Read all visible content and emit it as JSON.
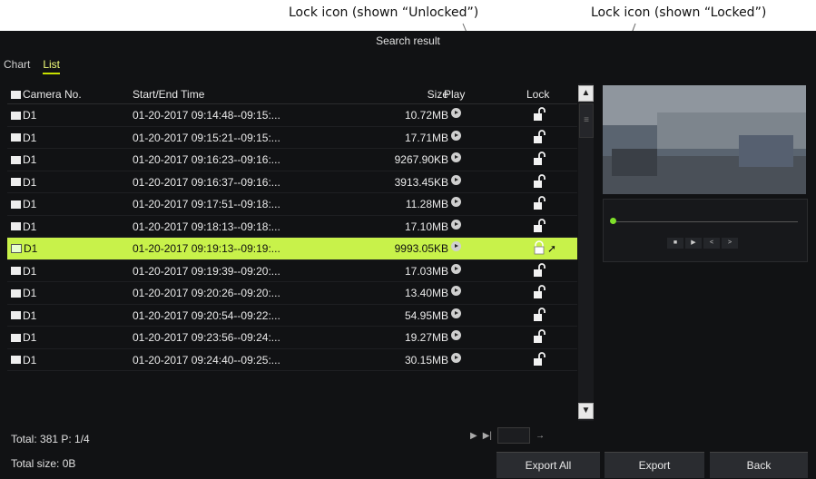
{
  "callouts": {
    "unlocked": "Lock icon (shown “Unlocked”)",
    "locked": "Lock icon (shown “Locked”)"
  },
  "window": {
    "title": "Search result"
  },
  "tabs": [
    {
      "label": "Chart",
      "active": false
    },
    {
      "label": "List",
      "active": true
    }
  ],
  "table": {
    "headers": {
      "camera": "Camera No.",
      "time": "Start/End Time",
      "size": "Size",
      "play": "Play",
      "lock": "Lock"
    },
    "rows": [
      {
        "camera": "D1",
        "time": "01-20-2017 09:14:48--09:15:...",
        "size": "10.72MB",
        "lock_icon": "unlocked-lock-icon"
      },
      {
        "camera": "D1",
        "time": "01-20-2017 09:15:21--09:15:...",
        "size": "17.71MB",
        "lock_icon": "unlocked-lock-icon"
      },
      {
        "camera": "D1",
        "time": "01-20-2017 09:16:23--09:16:...",
        "size": "9267.90KB",
        "lock_icon": "unlocked-lock-icon"
      },
      {
        "camera": "D1",
        "time": "01-20-2017 09:16:37--09:16:...",
        "size": "3913.45KB",
        "lock_icon": "unlocked-lock-icon"
      },
      {
        "camera": "D1",
        "time": "01-20-2017 09:17:51--09:18:...",
        "size": "11.28MB",
        "lock_icon": "unlocked-lock-icon"
      },
      {
        "camera": "D1",
        "time": "01-20-2017 09:18:13--09:18:...",
        "size": "17.10MB",
        "lock_icon": "unlocked-lock-icon"
      },
      {
        "camera": "D1",
        "time": "01-20-2017 09:19:13--09:19:...",
        "size": "9993.05KB",
        "lock_icon": "locked-lock-icon",
        "selected": true
      },
      {
        "camera": "D1",
        "time": "01-20-2017 09:19:39--09:20:...",
        "size": "17.03MB",
        "lock_icon": "unlocked-lock-icon"
      },
      {
        "camera": "D1",
        "time": "01-20-2017 09:20:26--09:20:...",
        "size": "13.40MB",
        "lock_icon": "unlocked-lock-icon"
      },
      {
        "camera": "D1",
        "time": "01-20-2017 09:20:54--09:22:...",
        "size": "54.95MB",
        "lock_icon": "unlocked-lock-icon"
      },
      {
        "camera": "D1",
        "time": "01-20-2017 09:23:56--09:24:...",
        "size": "19.27MB",
        "lock_icon": "unlocked-lock-icon"
      },
      {
        "camera": "D1",
        "time": "01-20-2017 09:24:40--09:25:...",
        "size": "30.15MB",
        "lock_icon": "unlocked-lock-icon"
      }
    ]
  },
  "footer": {
    "total": "Total: 381  P: 1/4",
    "total_size": "Total size: 0B"
  },
  "buttons": {
    "export_all": "Export All",
    "export": "Export",
    "back": "Back"
  },
  "colors": {
    "background": "#111214",
    "selected_row": "#c8f24a",
    "active_tab": "#f3ff7a",
    "progress_knob": "#7fe02a"
  }
}
